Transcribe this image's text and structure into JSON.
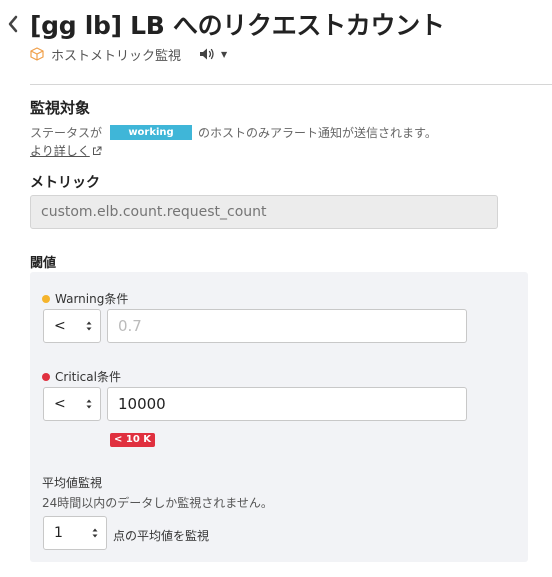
{
  "header": {
    "title": "[gg lb] LB へのリクエストカウント",
    "monitor_type": "ホストメトリック監視"
  },
  "target": {
    "heading": "監視対象",
    "status_prefix": "ステータスが",
    "status_value": "working",
    "status_suffix": "のホストのみアラート通知が送信されます。",
    "more_link": "より詳しく"
  },
  "metric": {
    "heading": "メトリック",
    "placeholder": "custom.elb.count.request_count"
  },
  "threshold": {
    "heading": "閾値",
    "warning": {
      "label": "Warning条件",
      "operator": "<",
      "value": "",
      "placeholder": "0.7",
      "color": "#f5b42c"
    },
    "critical": {
      "label": "Critical条件",
      "operator": "<",
      "value": "10000",
      "hint": "< 10 K",
      "color": "#e0303f"
    },
    "average": {
      "title": "平均値監視",
      "description": "24時間以内のデータしか監視されません。",
      "points": "1",
      "suffix": "点の平均値を監視"
    }
  },
  "colors": {
    "status_badge": "#3fb6d8"
  }
}
